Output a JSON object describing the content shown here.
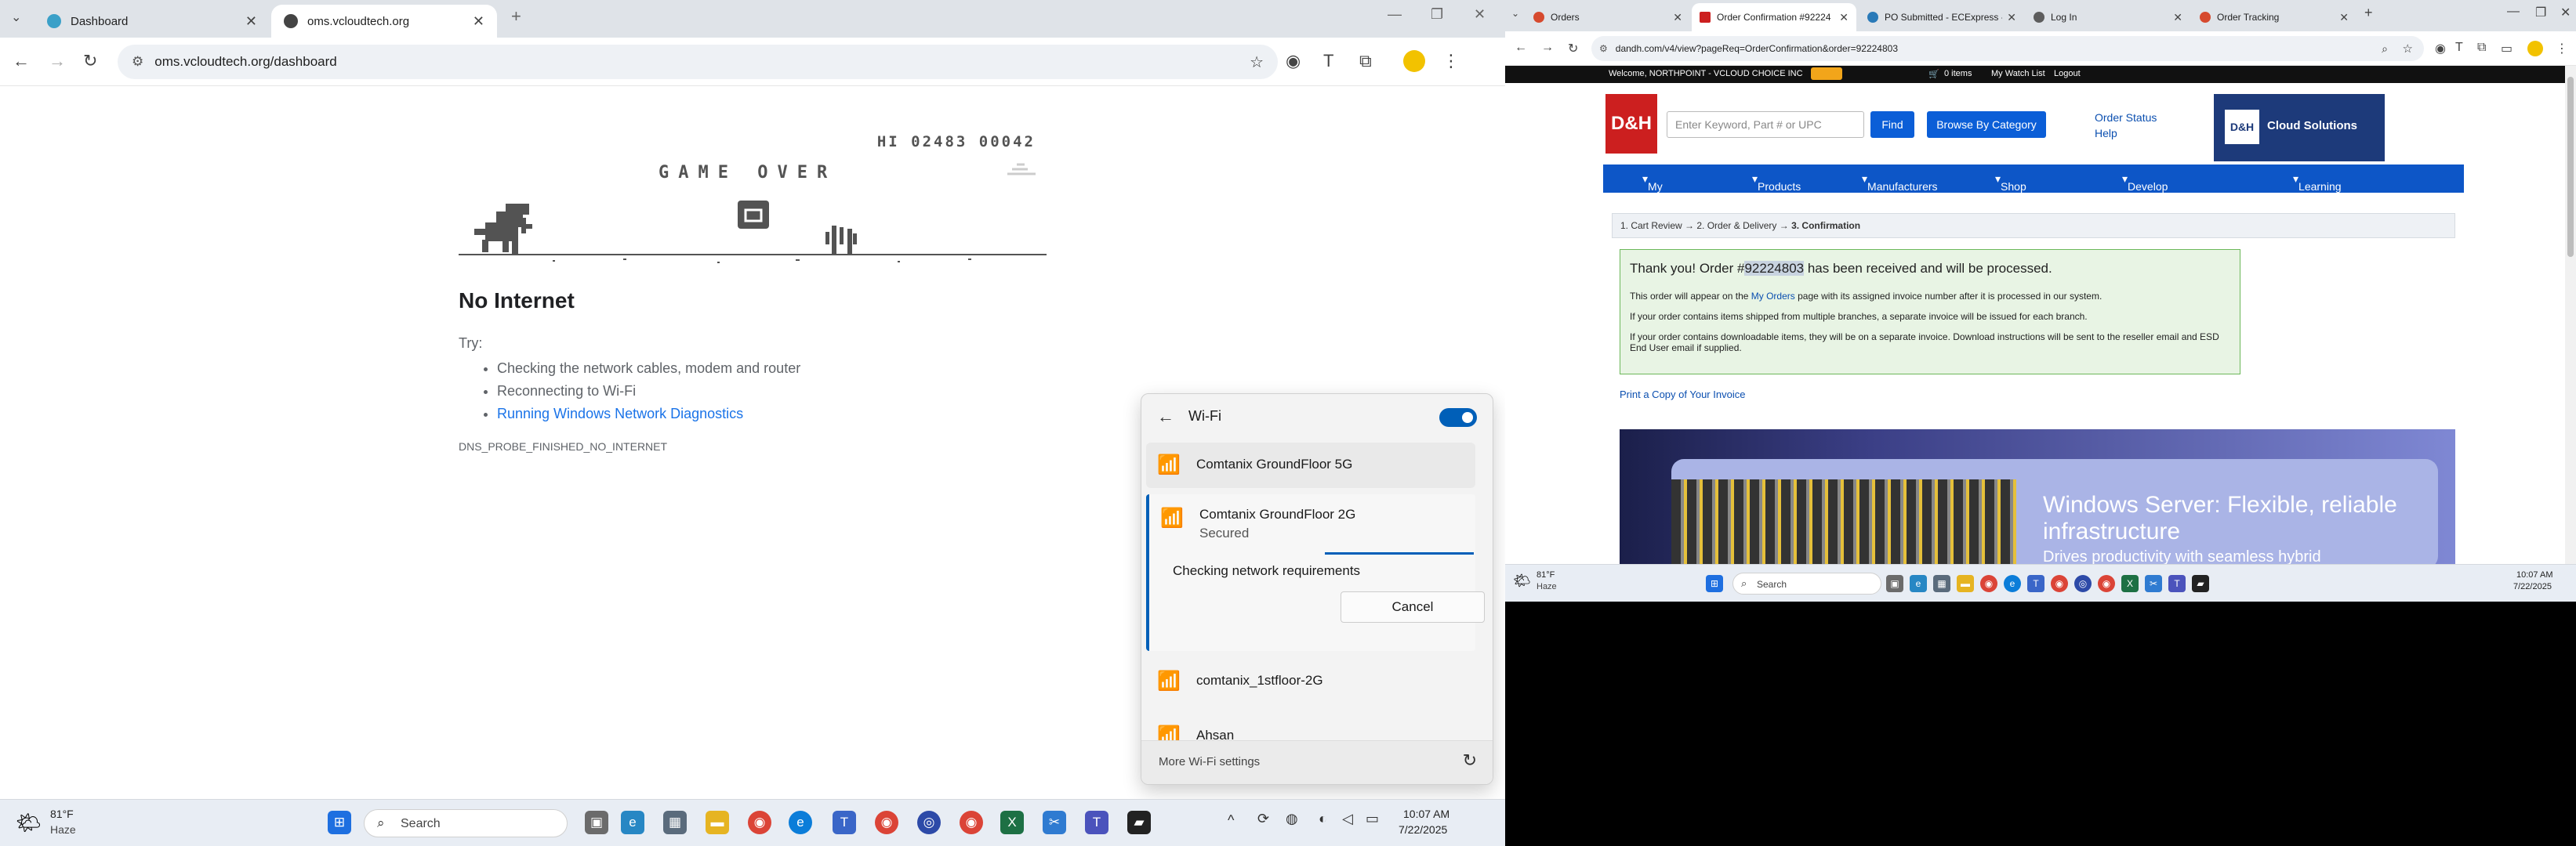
{
  "left": {
    "tabs": [
      {
        "title": "Dashboard",
        "active": false
      },
      {
        "title": "oms.vcloudtech.org",
        "active": true
      }
    ],
    "url": "oms.vcloudtech.org/dashboard",
    "dino": {
      "score": "HI 02483 00042",
      "game_over": "GAME OVER"
    },
    "error": {
      "title": "No Internet",
      "try_label": "Try:",
      "suggestions": [
        "Checking the network cables, modem and router",
        "Reconnecting to Wi-Fi"
      ],
      "diagnostics_link": "Running Windows Network Diagnostics",
      "code": "DNS_PROBE_FINISHED_NO_INTERNET"
    },
    "wifi": {
      "title": "Wi-Fi",
      "enabled": true,
      "networks": [
        {
          "name": "Comtanix GroundFloor 5G"
        },
        {
          "name": "Comtanix GroundFloor 2G",
          "status": "Secured",
          "progress_text": "Checking network requirements",
          "cancel_label": "Cancel"
        },
        {
          "name": "comtanix_1stfloor-2G"
        },
        {
          "name": "Ahsan"
        }
      ],
      "more_settings": "More Wi-Fi settings"
    },
    "taskbar": {
      "weather_temp": "81°F",
      "weather_desc": "Haze",
      "search_placeholder": "Search",
      "time": "10:07 AM",
      "date": "7/22/2025"
    }
  },
  "right": {
    "tabs": [
      {
        "title": "Orders"
      },
      {
        "title": "Order Confirmation #92224"
      },
      {
        "title": "PO Submitted - ECExpress -"
      },
      {
        "title": "Log In"
      },
      {
        "title": "Order Tracking"
      }
    ],
    "url": "dandh.com/v4/view?pageReq=OrderConfirmation&order=92224803",
    "topbar": {
      "welcome": "Welcome, NORTHPOINT - VCLOUD CHOICE INC",
      "cart": "0 items",
      "watchlist": "My Watch List",
      "logout": "Logout"
    },
    "header": {
      "logo": "D&H",
      "search_placeholder": "Enter Keyword, Part # or UPC",
      "find": "Find",
      "browse": "Browse By Category",
      "order_status": "Order Status",
      "help": "Help",
      "cloud_solutions": "Cloud Solutions"
    },
    "nav": [
      "My D&H",
      "Products",
      "Manufacturers",
      "Shop By...",
      "Develop Your Business",
      "Learning & Training"
    ],
    "steps": [
      "1. Cart Review",
      "2. Order & Delivery",
      "3. Confirmation"
    ],
    "confirmation": {
      "headline_pre": "Thank you! Order #",
      "order_number": "92224803",
      "headline_post": "has been received and will be processed.",
      "line1_pre": "This order will appear on the ",
      "line1_link": "My Orders",
      "line1_post": " page with its assigned invoice number after it is processed in our system.",
      "line2": "If your order contains items shipped from multiple branches, a separate invoice will be issued for each branch.",
      "line3": "If your order contains downloadable items, they will be on a separate invoice. Download instructions will be sent to the reseller email and ESD End User email if supplied."
    },
    "print_link": "Print a Copy of Your Invoice",
    "banner": {
      "title": "Windows Server: Flexible, reliable infrastructure",
      "subtitle": "Drives productivity with seamless hybrid"
    },
    "taskbar": {
      "weather_temp": "81°F",
      "weather_desc": "Haze",
      "search_placeholder": "Search",
      "time": "10:07 AM",
      "date": "7/22/2025"
    }
  }
}
